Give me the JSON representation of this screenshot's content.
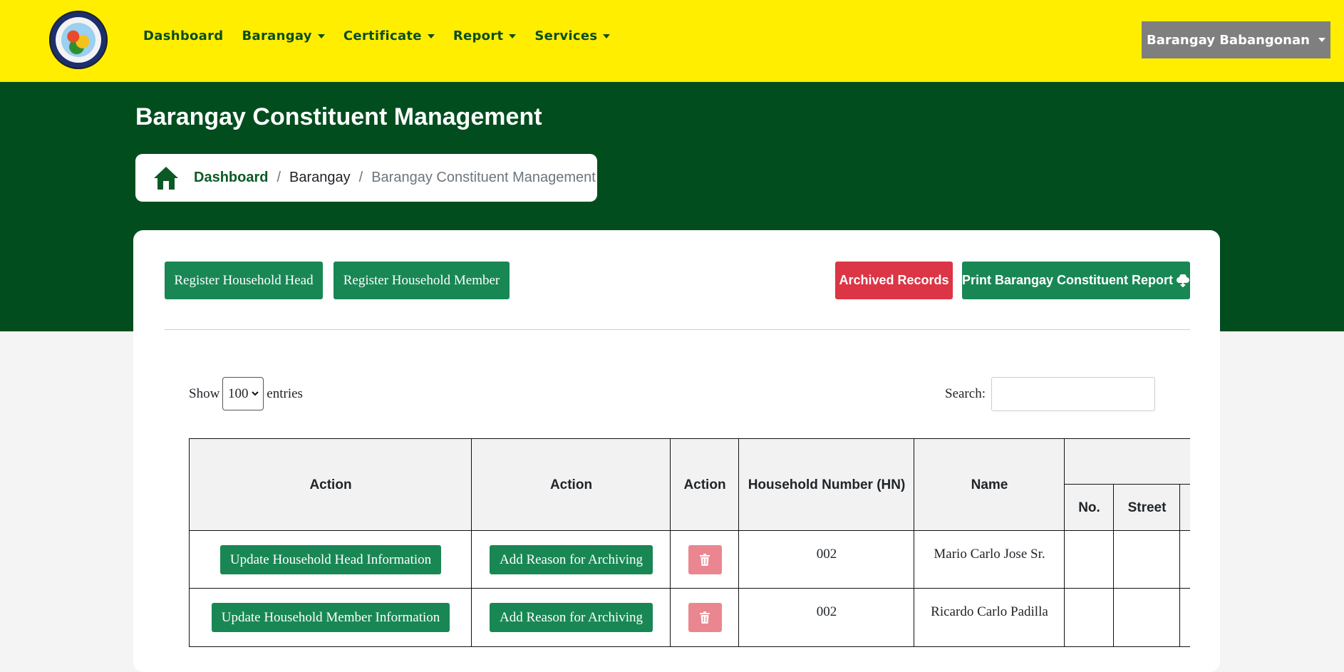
{
  "nav": {
    "logo_alt": "Municipality of Victoria Official Seal",
    "items": [
      {
        "label": "Dashboard",
        "dropdown": false
      },
      {
        "label": "Barangay",
        "dropdown": true
      },
      {
        "label": "Certificate",
        "dropdown": true
      },
      {
        "label": "Report",
        "dropdown": true
      },
      {
        "label": "Services",
        "dropdown": true
      }
    ],
    "user_menu": "Barangay Babangonan"
  },
  "page": {
    "title": "Barangay Constituent Management",
    "breadcrumb": [
      "Dashboard",
      "Barangay",
      "Barangay Constituent Management"
    ]
  },
  "toolbar": {
    "register_head": "Register Household Head",
    "register_member": "Register Household Member",
    "archived": "Archived Records",
    "print_report": "Print Barangay Constituent Report",
    "print_icon": "cloud-download-icon"
  },
  "table_controls": {
    "show_label": "Show",
    "entries_value": "100",
    "entries_label": "entries",
    "search_label": "Search:",
    "search_value": ""
  },
  "table": {
    "headers": [
      "Action",
      "Action",
      "Action",
      "Household Number (HN)",
      "Name"
    ],
    "sub_headers": [
      "No.",
      "Street"
    ],
    "rows": [
      {
        "update": "Update Household Head Information",
        "archive": "Add Reason for Archiving",
        "hn": "002",
        "name": "Mario Carlo Jose Sr."
      },
      {
        "update": "Update Household Member Information",
        "archive": "Add Reason for Archiving",
        "hn": "002",
        "name": "Ricardo Carlo Padilla"
      }
    ]
  },
  "colors": {
    "nav_bg": "#ffee00",
    "hero_bg": "#014d1e",
    "primary": "#198754",
    "danger": "#dc3545",
    "trash": "#ea868f"
  }
}
